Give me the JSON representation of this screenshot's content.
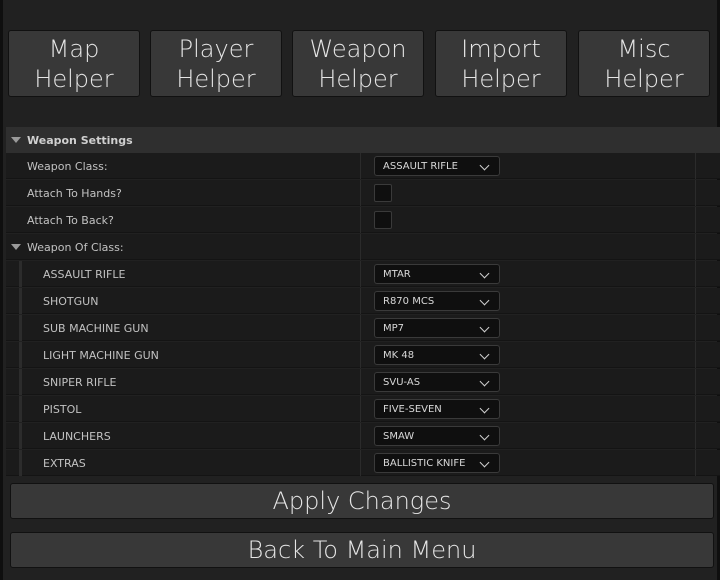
{
  "helpers": [
    {
      "label": "Map\nHelper"
    },
    {
      "label": "Player\nHelper"
    },
    {
      "label": "Weapon\nHelper"
    },
    {
      "label": "Import\nHelper"
    },
    {
      "label": "Misc\nHelper"
    }
  ],
  "section": {
    "title": "Weapon Settings",
    "weapon_class_label": "Weapon Class:",
    "weapon_class_value": "ASSAULT RIFLE",
    "attach_hands_label": "Attach To Hands?",
    "attach_back_label": "Attach To Back?",
    "weapon_of_class_label": "Weapon Of Class:"
  },
  "weapons": [
    {
      "class": "ASSAULT RIFLE",
      "value": "MTAR"
    },
    {
      "class": "SHOTGUN",
      "value": "R870 MCS"
    },
    {
      "class": "SUB MACHINE GUN",
      "value": "MP7"
    },
    {
      "class": "LIGHT MACHINE GUN",
      "value": "MK 48"
    },
    {
      "class": "SNIPER RIFLE",
      "value": "SVU-AS"
    },
    {
      "class": "PISTOL",
      "value": "FIVE-SEVEN"
    },
    {
      "class": "LAUNCHERS",
      "value": "SMAW"
    },
    {
      "class": "EXTRAS",
      "value": "BALLISTIC KNIFE"
    }
  ],
  "buttons": {
    "apply": "Apply Changes",
    "back": "Back To Main Menu"
  },
  "icons": {
    "collapse": "chevron-down-icon",
    "dropdown": "chevron-down-icon"
  }
}
